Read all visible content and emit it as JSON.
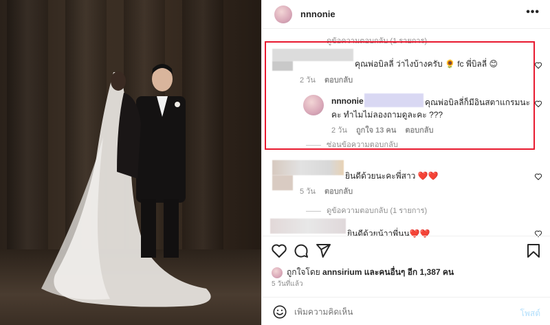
{
  "post": {
    "username": "nnnonie"
  },
  "comments": {
    "view_replies_top": "ดูข้อความตอบกลับ (1 รายการ)",
    "c1": {
      "text": "คุณพ่อบิลลี่ ว่าไงบ้างครับ 🌻 fc พี่บิลลี่ 😊",
      "time": "2 วัน",
      "reply": "ตอบกลับ"
    },
    "reply1": {
      "username": "nnnonie",
      "text_line1": "คุณพ่อบิลลี่ก็มีอินสตาแกรมนะ",
      "text_line2": "คะ ทำไมไม่ลองถามดูละคะ ???",
      "time": "2 วัน",
      "likes": "ถูกใจ 13 คน",
      "reply": "ตอบกลับ"
    },
    "hide_replies": "ซ่อนข้อความตอบกลับ",
    "c2": {
      "text": "ยินดีด้วยนะคะพี่สาว ❤️❤️",
      "time": "5 วัน",
      "reply": "ตอบกลับ"
    },
    "view_replies_2": "ดูข้อความตอบกลับ (1 รายการ)",
    "c3": {
      "text": "ยินดีด้วยน้าาพี่นน❤️❤️"
    }
  },
  "footer": {
    "liked_by_prefix": "ถูกใจโดย",
    "liked_by_user": "annsirium",
    "liked_by_suffix": "และคนอื่นๆ อีก 1,387 คน",
    "age": "5 วันที่แล้ว",
    "input_placeholder": "เพิ่มความคิดเห็น",
    "post_label": "โพสต์"
  },
  "icons": {
    "more": "more-icon",
    "heart": "heart-icon",
    "comment": "comment-icon",
    "share": "share-icon",
    "save": "bookmark-icon",
    "emoji": "emoji-icon"
  },
  "colors": {
    "highlight_border": "#e8182e",
    "post_button": "#b2dffc"
  }
}
